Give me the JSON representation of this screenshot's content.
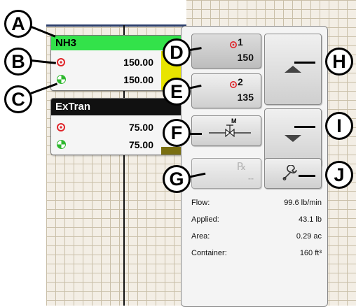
{
  "products": [
    {
      "name": "NH3",
      "header_color": "#33e24a",
      "target_rate": "150.00",
      "actual_rate": "150.00"
    },
    {
      "name": "ExTran",
      "header_color": "#111111",
      "target_rate": "75.00",
      "actual_rate": "75.00"
    }
  ],
  "rate_buttons": [
    {
      "number": "1",
      "value": "150"
    },
    {
      "number": "2",
      "value": "135"
    }
  ],
  "manual_button": {
    "label": "M"
  },
  "rx_button": {
    "label": "℞",
    "value": "--"
  },
  "stats": [
    {
      "label": "Flow:",
      "value": "99.6 lb/min"
    },
    {
      "label": "Applied:",
      "value": "43.1 lb"
    },
    {
      "label": "Area:",
      "value": "0.29 ac"
    },
    {
      "label": "Container:",
      "value": "160 ft³"
    }
  ],
  "callouts": [
    "A",
    "B",
    "C",
    "D",
    "E",
    "F",
    "G",
    "H",
    "I",
    "J"
  ],
  "icons": {
    "target_rate": "target-icon",
    "actual_rate": "actual-rate-icon",
    "increase": "triangle-up-icon",
    "decrease": "triangle-down-icon",
    "settings": "wrench-icon",
    "valve": "valve-icon"
  },
  "colors": {
    "target_red": "#e0262b",
    "actual_green": "#2fb82f",
    "gauge_yellow": "#e8e400",
    "gauge_olive": "#7a6f10"
  }
}
